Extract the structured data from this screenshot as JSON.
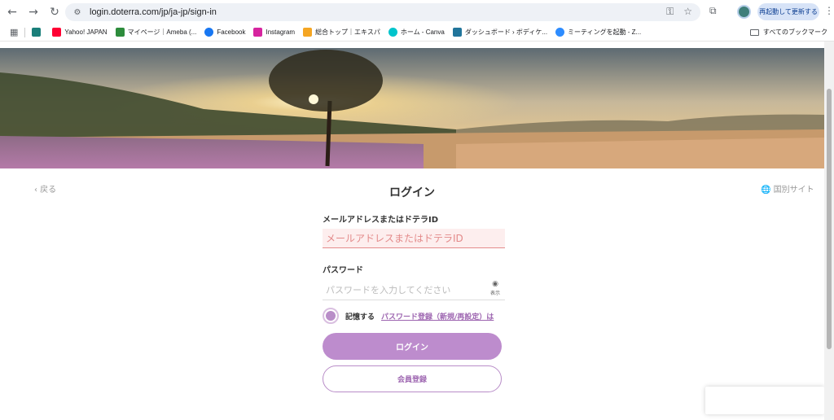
{
  "browser": {
    "url": "login.doterra.com/jp/ja-jp/sign-in",
    "restart_button": "再起動して更新する",
    "bookmarks": [
      {
        "label": "Yahoo! JAPAN",
        "color": "#ff0033"
      },
      {
        "label": "マイページ｜Ameba (...",
        "color": "#2d8c3c"
      },
      {
        "label": "Facebook",
        "color": "#1877f2"
      },
      {
        "label": "Instagram",
        "color": "#d6249f"
      },
      {
        "label": "総合トップ｜エキスパ",
        "color": "#f5a623"
      },
      {
        "label": "ホーム - Canva",
        "color": "#00c4cc"
      },
      {
        "label": "ダッシュボード › ボディケ...",
        "color": "#21759b"
      },
      {
        "label": "ミーティングを起動 - Z...",
        "color": "#2d8cff"
      }
    ],
    "all_bookmarks": "すべてのブックマーク"
  },
  "page": {
    "back_link": "‹ 戻る",
    "title": "ログイン",
    "global_site": "🌐 国別サイト",
    "email_label": "メールアドレスまたはドテラID",
    "email_placeholder": "メールアドレスまたはドテラID",
    "password_label": "パスワード",
    "password_placeholder": "パスワードを入力してください",
    "show_label": "表示",
    "remember_label": "記憶する",
    "password_link": "パスワード登録（新規/再設定）は",
    "login_button": "ログイン",
    "register_button": "会員登録"
  },
  "colors": {
    "accent": "#bd8ccd",
    "accent_dark": "#9d65b0",
    "error": "#e38a8a"
  }
}
